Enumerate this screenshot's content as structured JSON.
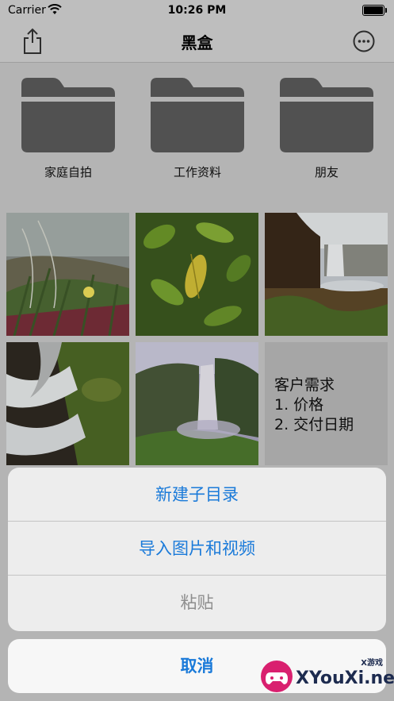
{
  "status_bar": {
    "carrier": "Carrier",
    "time": "10:26 PM"
  },
  "nav": {
    "title": "黑盒"
  },
  "folders": [
    {
      "label": "家庭自拍"
    },
    {
      "label": "工作资料"
    },
    {
      "label": "朋友"
    }
  ],
  "note": {
    "line1": "客户需求",
    "line2": "1. 价格",
    "line3": "2. 交付日期"
  },
  "action_sheet": {
    "new_folder": "新建子目录",
    "import_media": "导入图片和视频",
    "paste": "粘贴",
    "cancel": "取消"
  },
  "watermark": {
    "domain": "XYouXi.net",
    "tag": "X游戏"
  }
}
